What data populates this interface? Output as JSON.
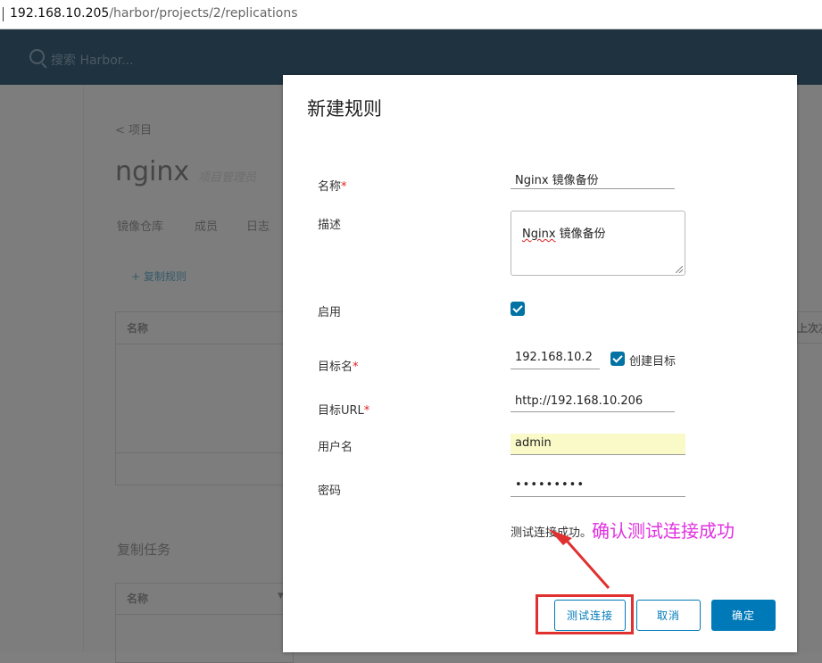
{
  "browser": {
    "url_host": "192.168.10.205",
    "url_path": "/harbor/projects/2/replications"
  },
  "header": {
    "search_placeholder": "搜索 Harbor..."
  },
  "background_page": {
    "back_link": "< 项目",
    "project_name": "nginx",
    "project_subtitle": "项目管理员",
    "tabs": [
      "镜像仓库",
      "成员",
      "日志"
    ],
    "add_rule_label": "+ 复制规则",
    "rules_table_header": "名称",
    "rules_table_header_right": "上次次",
    "jobs_section_title": "复制任务",
    "jobs_table_header": "名称"
  },
  "modal": {
    "title": "新建规则",
    "fields": {
      "name_label": "名称",
      "name_value": "Nginx 镜像备份",
      "description_label": "描述",
      "description_value_word1": "Nginx",
      "description_value_rest": " 镜像备份",
      "enable_label": "启用",
      "enable_checked": true,
      "target_name_label": "目标名",
      "target_name_value": "192.168.10.2",
      "create_target_label": "创建目标",
      "create_target_checked": true,
      "target_url_label": "目标URL",
      "target_url_value": "http://192.168.10.206",
      "username_label": "用户名",
      "username_value": "admin",
      "password_label": "密码",
      "password_value": "•••••••••"
    },
    "required_mark": "*",
    "status_text": "测试连接成功。",
    "buttons": {
      "test_connection": "测试连接",
      "cancel": "取消",
      "confirm": "确定"
    }
  },
  "annotation": {
    "text": "确认测试连接成功",
    "color": "#e030e0",
    "arrow_color": "#e03030"
  }
}
